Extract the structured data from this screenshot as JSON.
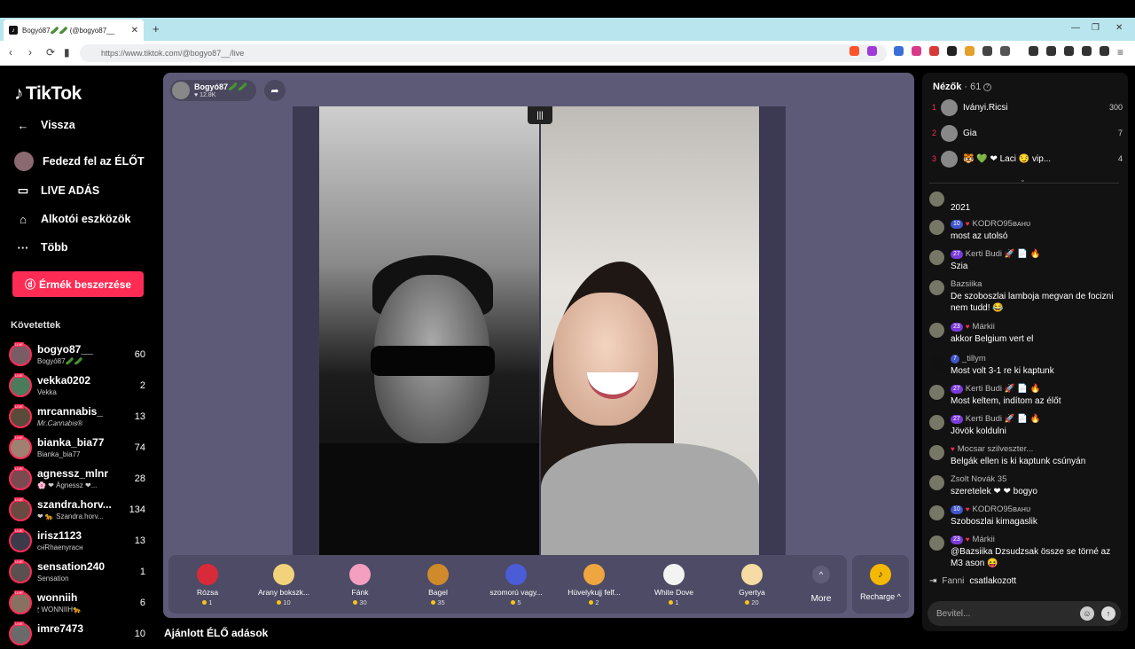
{
  "browser": {
    "tab_title": "Bogyó87🥒🥒 (@bogyo87__",
    "url": "https://www.tiktok.com/@bogyo87__/live"
  },
  "sidebar": {
    "logo": "TikTok",
    "menu": [
      "Vissza",
      "Fedezd fel az ÉLŐT",
      "LIVE ADÁS",
      "Alkotói eszközök",
      "Több"
    ],
    "coins_button": "Érmék beszerzése",
    "following_title": "Követettek",
    "following": [
      {
        "username": "bogyo87__",
        "nickname": "Bogyó87🥒🥒",
        "count": "60"
      },
      {
        "username": "vekka0202",
        "nickname": "Vekka",
        "count": "2"
      },
      {
        "username": "mrcannabis_",
        "nickname": "𝑀𝑟.𝐶𝑎𝑛𝑛𝑎𝑏𝑖𝑠®",
        "count": "13"
      },
      {
        "username": "bianka_bia77",
        "nickname": "Bianka_bia77",
        "count": "74"
      },
      {
        "username": "agnessz_mlnr",
        "nickname": "🌸 ❤ Ágnessz ❤...",
        "count": "28"
      },
      {
        "username": "szandra.horv...",
        "nickname": "❤ 🐆 Szandra.horv...",
        "count": "134"
      },
      {
        "username": "irisz1123",
        "nickname": "сн̈Rhaenyrасн",
        "count": "13"
      },
      {
        "username": "sensation240",
        "nickname": "Sensation",
        "count": "1"
      },
      {
        "username": "wonniih",
        "nickname": "🕯 WONNIIH🐆",
        "count": "6"
      },
      {
        "username": "imre7473",
        "nickname": "",
        "count": "10"
      }
    ]
  },
  "stream": {
    "host_name": "Bogyó87🥒🥒",
    "host_likes": "♥ 12.8K"
  },
  "gifts": [
    {
      "name": "Rózsa",
      "price": "1",
      "color": "#d92a3a"
    },
    {
      "name": "Arany bokszk...",
      "price": "10",
      "color": "#f2d27a"
    },
    {
      "name": "Fánk",
      "price": "30",
      "color": "#f49fc0"
    },
    {
      "name": "Bagel",
      "price": "35",
      "color": "#d08a2c"
    },
    {
      "name": "szomorú vagy...",
      "price": "5",
      "color": "#4a5cd6"
    },
    {
      "name": "Hüvelykujj felf...",
      "price": "2",
      "color": "#f0a640"
    },
    {
      "name": "White Dove",
      "price": "1",
      "color": "#f3f3f3"
    },
    {
      "name": "Gyertya",
      "price": "20",
      "color": "#f6dca4"
    }
  ],
  "more_label": "More",
  "recharge_label": "Recharge ^",
  "recommended_title": "Ajánlott ÉLŐ adások",
  "viewers": {
    "title": "Nézők",
    "count": "· 61",
    "top": [
      {
        "rank": "1",
        "name": "Iványi.Ricsi",
        "score": "300"
      },
      {
        "rank": "2",
        "name": "Gia",
        "score": "7"
      },
      {
        "rank": "3",
        "name": "🐯 💚 ❤ Laci 😏 vip...",
        "score": "4"
      }
    ]
  },
  "chat": [
    {
      "badge": "",
      "user": "",
      "text": "2021"
    },
    {
      "badge": "10",
      "user": "KODRO95ʙᴀʜᴜ",
      "text": "most az utolsó"
    },
    {
      "badge": "27",
      "user": "Kerti Budi 🚀 📄 🔥",
      "text": "Szia"
    },
    {
      "badge": "",
      "user": "Bazsiika",
      "text": "De szoboszlai lamboja megvan de focizni nem tudd! 😂"
    },
    {
      "badge": "23",
      "user": "Márkii",
      "text": "akkor Belgium vert el"
    },
    {
      "badge": "7",
      "user": "_tillym",
      "text": "Most volt 3-1 re ki kaptunk"
    },
    {
      "badge": "27",
      "user": "Kerti Budi 🚀 📄 🔥",
      "text": "Most keltem, indítom az élőt"
    },
    {
      "badge": "27",
      "user": "Kerti Budi 🚀 📄 🔥",
      "text": "Jövök koldulni"
    },
    {
      "badge": "",
      "user": "Mocsar szilveszter...",
      "text": "Belgák ellen is ki kaptunk csúnyán"
    },
    {
      "badge": "",
      "user": "Zsolt Novák 35",
      "text": "szeretelek ❤ ❤ bogyo"
    },
    {
      "badge": "10",
      "user": "KODRO95ʙᴀʜᴜ",
      "text": "Szoboszlai kimagaslik"
    },
    {
      "badge": "23",
      "user": "Márkii",
      "text": "@Bazsiika Dzsudzsak össze se törné az M3 ason 😝"
    }
  ],
  "joined": {
    "user": "Fanni",
    "text": "csatlakozott"
  },
  "chat_input_placeholder": "Bevitel..."
}
